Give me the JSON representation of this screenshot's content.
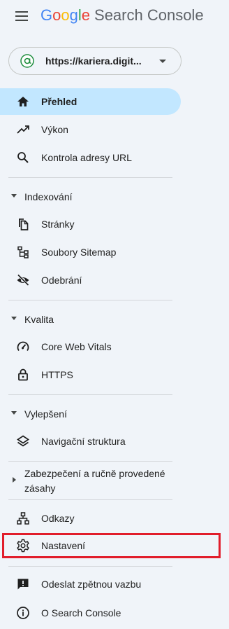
{
  "header": {
    "logo_letters": [
      "G",
      "o",
      "o",
      "g",
      "l",
      "e"
    ],
    "product": "Search Console"
  },
  "property": {
    "url": "https://kariera.digit..."
  },
  "nav": {
    "overview": "Přehled",
    "performance": "Výkon",
    "url_inspection": "Kontrola adresy URL",
    "indexing": {
      "title": "Indexování",
      "items": [
        "Stránky",
        "Soubory Sitemap",
        "Odebrání"
      ]
    },
    "quality": {
      "title": "Kvalita",
      "items": [
        "Core Web Vitals",
        "HTTPS"
      ]
    },
    "enhancements": {
      "title": "Vylepšení",
      "items": [
        "Navigační struktura"
      ]
    },
    "security": {
      "title": "Zabezpečení a ručně provedené zásahy"
    },
    "links": "Odkazy",
    "settings": "Nastavení",
    "feedback": "Odeslat zpětnou vazbu",
    "about": "O Search Console"
  },
  "colors": {
    "active_bg": "#c2e7ff",
    "highlight_border": "#e11d2b",
    "sidebar_bg": "#f0f4f9"
  }
}
